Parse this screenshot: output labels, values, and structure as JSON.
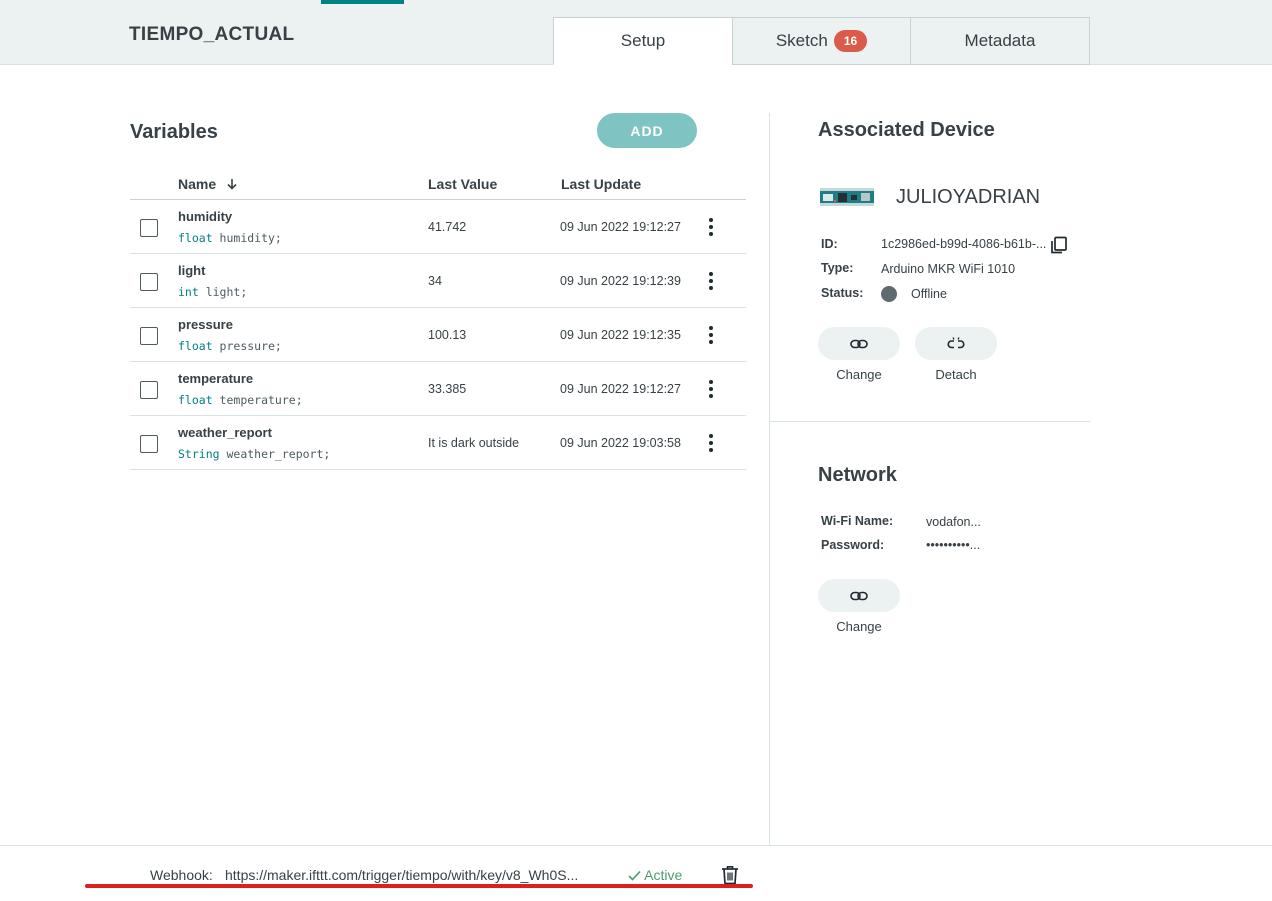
{
  "header": {
    "thing_name": "TIEMPO_ACTUAL",
    "tabs": [
      {
        "label": "Setup",
        "active": true
      },
      {
        "label": "Sketch",
        "badge": "16"
      },
      {
        "label": "Metadata"
      }
    ]
  },
  "variables": {
    "title": "Variables",
    "add_label": "ADD",
    "columns": {
      "name": "Name",
      "last_value": "Last Value",
      "last_update": "Last Update"
    },
    "rows": [
      {
        "name": "humidity",
        "type": "float",
        "decl": " humidity;",
        "value": "41.742",
        "updated": "09 Jun 2022 19:12:27"
      },
      {
        "name": "light",
        "type": "int",
        "decl": " light;",
        "value": "34",
        "updated": "09 Jun 2022 19:12:39"
      },
      {
        "name": "pressure",
        "type": "float",
        "decl": " pressure;",
        "value": "100.13",
        "updated": "09 Jun 2022 19:12:35"
      },
      {
        "name": "temperature",
        "type": "float",
        "decl": " temperature;",
        "value": "33.385",
        "updated": "09 Jun 2022 19:12:27"
      },
      {
        "name": "weather_report",
        "type": "String",
        "decl": " weather_report;",
        "value": "It is dark outside",
        "updated": "09 Jun 2022 19:03:58"
      }
    ]
  },
  "device": {
    "title": "Associated Device",
    "name": "JULIOYADRIAN",
    "id_label": "ID:",
    "id_value": "1c2986ed-b99d-4086-b61b-...",
    "type_label": "Type:",
    "type_value": "Arduino MKR WiFi 1010",
    "status_label": "Status:",
    "status_value": "Offline",
    "change_label": "Change",
    "detach_label": "Detach"
  },
  "network": {
    "title": "Network",
    "wifi_label": "Wi-Fi Name:",
    "wifi_value": "vodafon...",
    "password_label": "Password:",
    "password_value": "••••••••••...",
    "change_label": "Change"
  },
  "webhook": {
    "label": "Webhook:",
    "url": "https://maker.ifttt.com/trigger/tiempo/with/key/v8_Wh0S...",
    "status": "Active"
  },
  "colors": {
    "accent": "#008184",
    "add_button": "#7fc4c2",
    "badge": "#da5b4a",
    "active_status": "#4c9b6e",
    "annotation_underline": "#dc1f1f"
  }
}
